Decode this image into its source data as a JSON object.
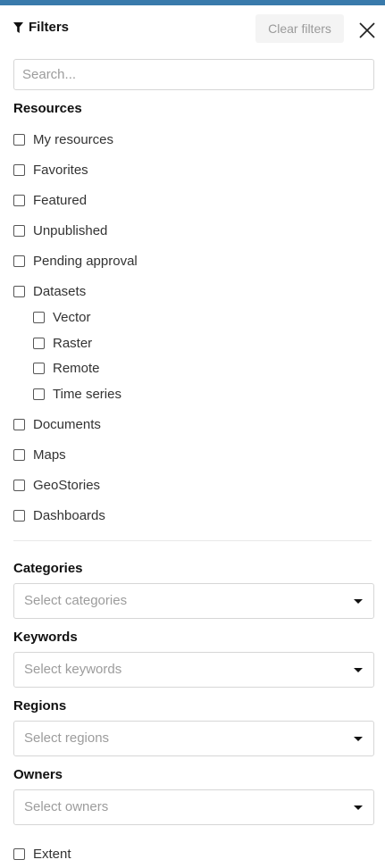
{
  "header": {
    "title": "Filters",
    "clear_label": "Clear filters"
  },
  "search": {
    "placeholder": "Search..."
  },
  "resources": {
    "title": "Resources",
    "items": [
      {
        "label": "My resources"
      },
      {
        "label": "Favorites"
      },
      {
        "label": "Featured"
      },
      {
        "label": "Unpublished"
      },
      {
        "label": "Pending approval"
      },
      {
        "label": "Datasets",
        "children": [
          {
            "label": "Vector"
          },
          {
            "label": "Raster"
          },
          {
            "label": "Remote"
          },
          {
            "label": "Time series"
          }
        ]
      },
      {
        "label": "Documents"
      },
      {
        "label": "Maps"
      },
      {
        "label": "GeoStories"
      },
      {
        "label": "Dashboards"
      }
    ]
  },
  "categories": {
    "title": "Categories",
    "placeholder": "Select categories"
  },
  "keywords": {
    "title": "Keywords",
    "placeholder": "Select keywords"
  },
  "regions": {
    "title": "Regions",
    "placeholder": "Select regions"
  },
  "owners": {
    "title": "Owners",
    "placeholder": "Select owners"
  },
  "extent": {
    "label": "Extent"
  },
  "colors": {
    "accent_bar": "#397aab"
  }
}
